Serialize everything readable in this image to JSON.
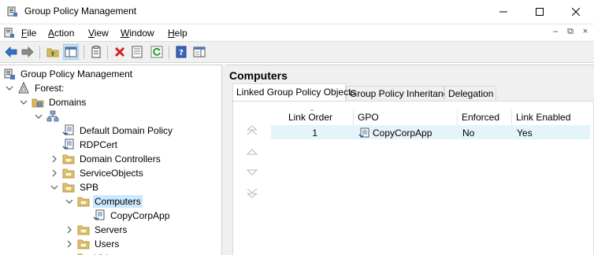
{
  "window": {
    "title": "Group Policy Management"
  },
  "menu": {
    "items": [
      {
        "label": "File",
        "accel": "F",
        "rest": "ile"
      },
      {
        "label": "Action",
        "accel": "A",
        "rest": "ction"
      },
      {
        "label": "View",
        "accel": "V",
        "rest": "iew"
      },
      {
        "label": "Window",
        "accel": "W",
        "rest": "indow"
      },
      {
        "label": "Help",
        "accel": "H",
        "rest": "elp"
      }
    ],
    "mdi_minimize": "–",
    "mdi_restore": "⧉",
    "mdi_close": "×"
  },
  "toolbar": {
    "buttons": [
      "back-arrow-icon",
      "forward-arrow-icon",
      "up-folder-icon",
      "show-hide-tree-icon",
      "clipboard-icon",
      "delete-icon",
      "properties-icon",
      "refresh-icon",
      "help-icon",
      "action-pane-icon"
    ]
  },
  "tree": {
    "items": [
      {
        "label": "Group Policy Management",
        "level": 0,
        "expander": "none",
        "icon": "gpm-icon"
      },
      {
        "label": "Forest:",
        "level": 1,
        "expander": "expanded",
        "icon": "forest-icon"
      },
      {
        "label": "Domains",
        "level": 2,
        "expander": "expanded",
        "icon": "domains-folder-icon"
      },
      {
        "label": "",
        "level": 3,
        "expander": "expanded",
        "icon": "domain-icon"
      },
      {
        "label": "Default Domain Policy",
        "level": 4,
        "expander": "none",
        "icon": "gpo-link-icon"
      },
      {
        "label": "RDPCert",
        "level": 4,
        "expander": "none",
        "icon": "gpo-link-icon"
      },
      {
        "label": "Domain Controllers",
        "level": 4,
        "expander": "collapsed",
        "icon": "ou-icon"
      },
      {
        "label": "ServiceObjects",
        "level": 4,
        "expander": "collapsed",
        "icon": "ou-icon"
      },
      {
        "label": "SPB",
        "level": 4,
        "expander": "expanded",
        "icon": "ou-icon"
      },
      {
        "label": "Computers",
        "level": 5,
        "expander": "expanded",
        "icon": "ou-icon",
        "selected": true
      },
      {
        "label": "CopyCorpApp",
        "level": 6,
        "expander": "none",
        "icon": "gpo-link-icon"
      },
      {
        "label": "Servers",
        "level": 5,
        "expander": "collapsed",
        "icon": "ou-icon"
      },
      {
        "label": "Users",
        "level": 5,
        "expander": "collapsed",
        "icon": "ou-icon"
      },
      {
        "label": "VV",
        "level": 5,
        "expander": "collapsed",
        "icon": "ou-icon"
      }
    ]
  },
  "content": {
    "title": "Computers",
    "tabs": [
      {
        "label": "Linked Group Policy Objects",
        "active": true
      },
      {
        "label": "Group Policy Inheritance",
        "active": false
      },
      {
        "label": "Delegation",
        "active": false
      }
    ],
    "columns": [
      "Link Order",
      "GPO",
      "Enforced",
      "Link Enabled"
    ],
    "rows": [
      {
        "link_order": "1",
        "gpo": "CopyCorpApp",
        "enforced": "No",
        "link_enabled": "Yes"
      }
    ],
    "order_buttons": [
      "move-to-top-icon",
      "move-up-icon",
      "move-down-icon",
      "move-to-bottom-icon"
    ]
  },
  "colors": {
    "selection": "#cce8ff",
    "row_highlight": "#e5f3fb",
    "folder_yellow": "#dcb85a"
  }
}
